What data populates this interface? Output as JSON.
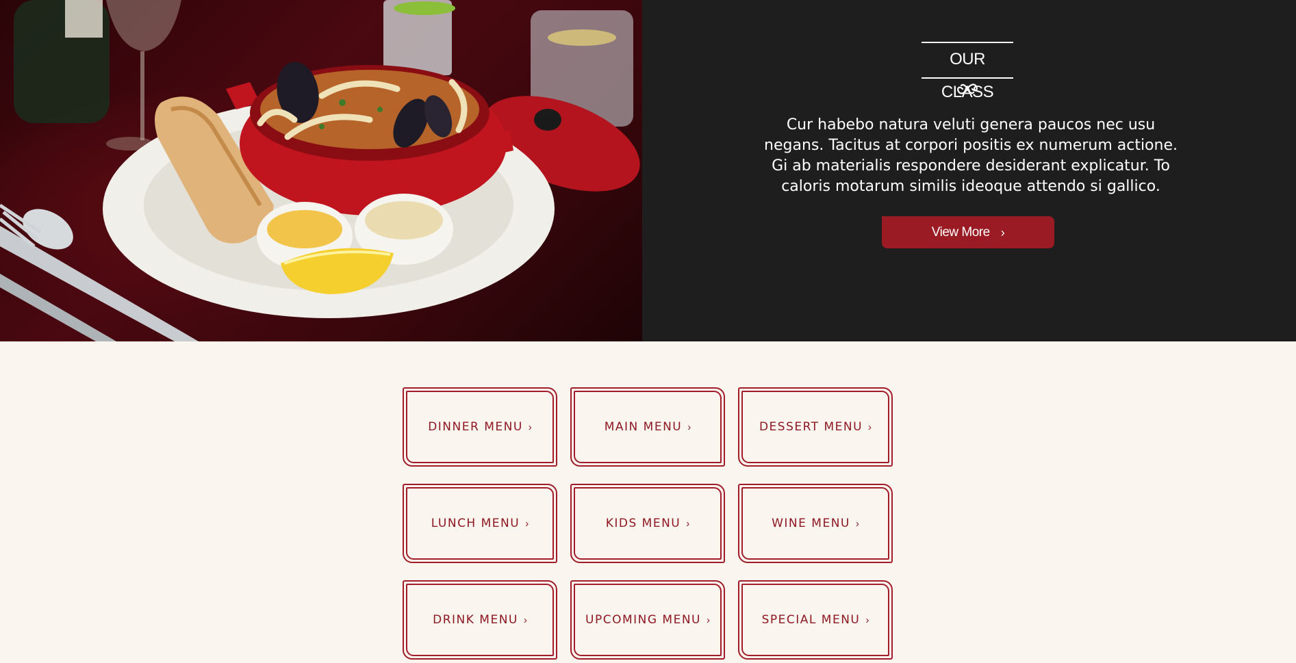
{
  "hero": {
    "image_alt": "Seafood stew in red pot with bread, sauces and lemon",
    "section_title": "OUR CLASS",
    "divider_icon": "knot-icon",
    "description": "Cur habebo natura veluti genera paucos nec usu negans. Tacitus at corpori positis ex numerum actione. Gi ab materialis respondere desiderant explicatur. To caloris motarum similis ideoque attendo si gallico.",
    "button_label": "View More",
    "button_icon": "chevron-right-icon"
  },
  "menus": [
    {
      "label": "DINNER  MENU"
    },
    {
      "label": "MAIN  MENU"
    },
    {
      "label": "DESSERT  MENU"
    },
    {
      "label": "LUNCH  MENU"
    },
    {
      "label": "KIDS  MENU"
    },
    {
      "label": "WINE  MENU"
    },
    {
      "label": "DRINK  MENU"
    },
    {
      "label": "UPCOMING  MENU"
    },
    {
      "label": "SPECIAL  MENU"
    }
  ],
  "colors": {
    "accent": "#9a1b24",
    "menu_text": "#8e1722",
    "dark_panel": "#1e1e1e",
    "page_bg": "#faf5ee"
  }
}
